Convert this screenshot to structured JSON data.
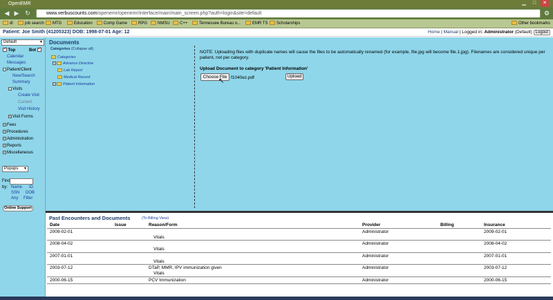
{
  "browser": {
    "tab_title": "OpenEMR",
    "url_domain": "www.verbuscounts.com",
    "url_path": "/openemr/openemr/interface/main/main_screen.php?auth=login&site=default",
    "bookmarks": [
      "dl",
      "job search",
      "MTG",
      "Education",
      "Comp Game",
      "RPG",
      "NMSU",
      "C++",
      "Tennessee Bureau o...",
      "EMR TS",
      "Scholarships"
    ],
    "other_bookmarks": "Other bookmarks"
  },
  "header": {
    "patient": "Patient: Joe Smith (41205323)  DOB: 1998-07-01 Age: 12",
    "home": "Home",
    "manual": "Manual",
    "logged_in": "Logged in:",
    "user": "Administrator",
    "site": "(Default)",
    "logout": "Logout"
  },
  "nav": {
    "menu_select": "Default",
    "top": "Top",
    "bot": "Bot",
    "calendar": "Calendar",
    "messages": "Messages",
    "patient_client": "Patient/Client",
    "new_search": "New/Search",
    "summary": "Summary",
    "visits": "Visits",
    "create_visit": "Create Visit",
    "current": "Current",
    "visit_history": "Visit History",
    "visit_forms": "Visit Forms",
    "fees": "Fees",
    "procedures": "Procedures",
    "administration": "Administration",
    "reports": "Reports",
    "miscellaneous": "Miscellaneous",
    "popups": "Popups",
    "find": "Find:",
    "by": "by:",
    "name": "Name",
    "id": "ID",
    "ssn": "SSN",
    "dob": "DOB",
    "any": "Any",
    "filter": "Filter",
    "online_support": "Online Support"
  },
  "documents": {
    "title": "Documents",
    "categories_label": "Categories",
    "collapse_all": "(Collapse all)",
    "root": "Categories",
    "items": [
      "Advance Directive",
      "Lab Report",
      "Medical Record",
      "Patient Information"
    ],
    "note": "NOTE: Uploading files with duplicate names will cause the files to be automatically renamed (for example, file.jpg will become file.1.jpg). Filenames are considered unique per patient, not per category.",
    "upload_title": "Upload Document to category 'Patient Information'",
    "choose_file": "Choose File",
    "file_name": "f1040ez.pdf",
    "upload": "Upload"
  },
  "encounters": {
    "title": "Past Encounters and Documents",
    "billing_view": "(To Billing View)",
    "columns": [
      "Date",
      "Issue",
      "Reason/Form",
      "Provider",
      "Billing",
      "Insurance"
    ],
    "rows": [
      {
        "date": "2009-02-01",
        "reason": "",
        "form": "Vitals",
        "provider": "Administrator",
        "insurance": "2009-02-01"
      },
      {
        "date": "2008-04-02",
        "reason": "",
        "form": "Vitals",
        "provider": "Administrator",
        "insurance": "2008-04-02"
      },
      {
        "date": "2007-01-01",
        "reason": "",
        "form": "Vitals",
        "provider": "Administrator",
        "insurance": "2007-01-01"
      },
      {
        "date": "2003-07-12",
        "reason": "DTaP, MMR, IPV immunization given",
        "form": "Vitals",
        "provider": "Administrator",
        "insurance": "2003-07-12"
      },
      {
        "date": "2000-06-15",
        "reason": "PCV Immunization",
        "form": "",
        "provider": "Administrator",
        "insurance": "2000-06-15"
      }
    ]
  }
}
